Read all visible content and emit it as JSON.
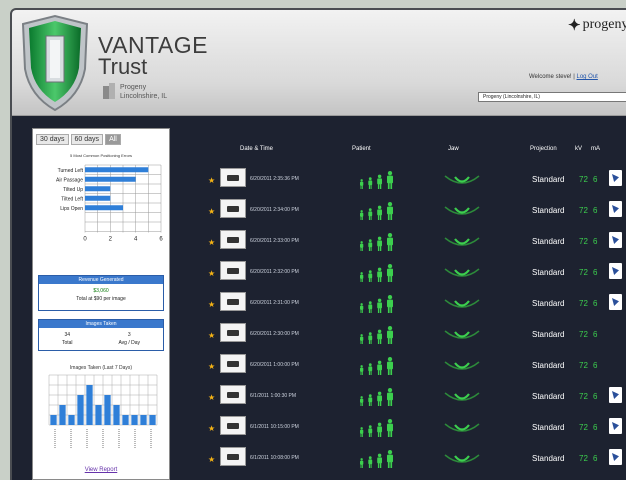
{
  "header": {
    "brand_name": "VANTAGE",
    "brand_sub": "Trust",
    "site_line1": "Progeny",
    "site_line2": "Lincolnshire, IL",
    "logo_text": "progeny",
    "welcome_text": "Welcome steve!",
    "separator": " | ",
    "logout_label": "Log Out",
    "site_select_value": "Progeny (Lincolnshire, IL)"
  },
  "left_panel": {
    "periods": [
      "30 days",
      "60 days",
      "All"
    ],
    "active_period": "All",
    "errors_title": "5 Most Common Positioning Errors",
    "errors_chart": {
      "type": "bar",
      "categories": [
        "Turned Left",
        "Air Passage",
        "Tilted Up",
        "Tilted Left",
        "Lips Open"
      ],
      "values": [
        5,
        4,
        2,
        2,
        3
      ],
      "xlim": [
        0,
        6
      ],
      "x_ticks": [
        "0",
        "2",
        "4",
        "6"
      ]
    },
    "revenue": {
      "title": "Revenue Generated",
      "value": "$3,060",
      "subtitle": "Total at $90 per image"
    },
    "images_taken": {
      "title": "Images Taken",
      "total_value": "34",
      "total_label": "Total",
      "avg_value": "3",
      "avg_label": "Avg / Day"
    },
    "images_chart_title": "Images Taken (Last 7 Days)",
    "images_chart": {
      "type": "bar",
      "values": [
        1,
        2,
        1,
        3,
        4,
        2,
        3,
        2,
        1,
        1,
        1,
        1
      ],
      "ylim": [
        0,
        5
      ]
    },
    "view_report_label": "View Report"
  },
  "table": {
    "headers": {
      "datetime": "Date & Time",
      "patient": "Patient",
      "jaw": "Jaw",
      "projection": "Projection",
      "kv": "kV",
      "ma": "mA"
    },
    "rows": [
      {
        "datetime": "6/20/2011 2:35:36 PM",
        "projection": "Standard",
        "kv": "72",
        "ma": "6",
        "has_doc": true
      },
      {
        "datetime": "6/20/2011 2:34:00 PM",
        "projection": "Standard",
        "kv": "72",
        "ma": "6",
        "has_doc": true
      },
      {
        "datetime": "6/20/2011 2:33:00 PM",
        "projection": "Standard",
        "kv": "72",
        "ma": "6",
        "has_doc": true
      },
      {
        "datetime": "6/20/2011 2:32:00 PM",
        "projection": "Standard",
        "kv": "72",
        "ma": "6",
        "has_doc": true
      },
      {
        "datetime": "6/20/2011 2:31:00 PM",
        "projection": "Standard",
        "kv": "72",
        "ma": "6",
        "has_doc": true
      },
      {
        "datetime": "6/20/2011 2:30:00 PM",
        "projection": "Standard",
        "kv": "72",
        "ma": "6",
        "has_doc": false
      },
      {
        "datetime": "6/20/2011 1:00:00 PM",
        "projection": "Standard",
        "kv": "72",
        "ma": "6",
        "has_doc": false
      },
      {
        "datetime": "6/1/2011 1:00:30 PM",
        "projection": "Standard",
        "kv": "72",
        "ma": "6",
        "has_doc": true
      },
      {
        "datetime": "6/1/2011 10:15:00 PM",
        "projection": "Standard",
        "kv": "72",
        "ma": "6",
        "has_doc": true
      },
      {
        "datetime": "6/1/2011 10:08:00 PM",
        "projection": "Standard",
        "kv": "72",
        "ma": "6",
        "has_doc": true
      }
    ],
    "pager": "• • • •"
  },
  "colors": {
    "background": "#1d2230",
    "accent_green": "#3ccf4e",
    "accent_blue": "#3a78cc",
    "star": "#f5b315"
  },
  "icons": {
    "row_star": "star-icon",
    "thumbnail": "xray-thumbnail-icon",
    "patient": "patient-figures-icon",
    "jaw": "jaw-arch-icon",
    "report": "document-icon"
  }
}
